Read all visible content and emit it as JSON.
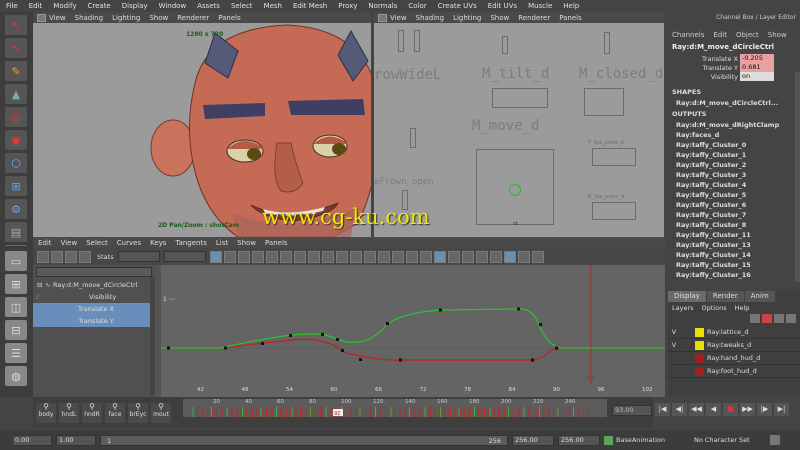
{
  "menubar": [
    "File",
    "Edit",
    "Modify",
    "Create",
    "Display",
    "Window",
    "Assets",
    "Select",
    "Mesh",
    "Edit Mesh",
    "Proxy",
    "Normals",
    "Color",
    "Create UVs",
    "Edit UVs",
    "Muscle",
    "Help"
  ],
  "viewport_left": {
    "menu": [
      "View",
      "Shading",
      "Lighting",
      "Show",
      "Renderer",
      "Panels"
    ],
    "resolution": "1280 x 720",
    "hud": "2D Pan/Zoom : shotCam"
  },
  "viewport_right": {
    "menu": [
      "View",
      "Shading",
      "Lighting",
      "Show",
      "Renderer",
      "Panels"
    ],
    "labels": {
      "frown": "rowWideL",
      "tilt": "M_tilt_d",
      "closed": "M_closed_d",
      "move": "M_move_d",
      "frown_open": "eFrown_open",
      "lips_press": "T_lips_press_d",
      "lips_press2": "B_lips_press_d",
      "shape_label": "ot"
    }
  },
  "watermark": "www.cg-ku.com",
  "channelbox": {
    "title": "Channel Box / Layer Editor",
    "menus": [
      "Channels",
      "Edit",
      "Object",
      "Show"
    ],
    "node": "Ray:d:M_move_dCircleCtrl",
    "attrs": [
      {
        "label": "Translate X",
        "value": "-0.205"
      },
      {
        "label": "Translate Y",
        "value": "0.681"
      },
      {
        "label": "Visibility",
        "value": "on"
      }
    ],
    "shapes_label": "SHAPES",
    "shape_item": "Ray:d:M_move_dCircleCtrl...",
    "outputs_label": "OUTPUTS",
    "outputs": [
      "Ray:d:M_move_dRightClamp",
      "Ray:faces_d",
      "Ray:taffy_Cluster_0",
      "Ray:taffy_Cluster_1",
      "Ray:taffy_Cluster_2",
      "Ray:taffy_Cluster_3",
      "Ray:taffy_Cluster_4",
      "Ray:taffy_Cluster_5",
      "Ray:taffy_Cluster_6",
      "Ray:taffy_Cluster_7",
      "Ray:taffy_Cluster_8",
      "Ray:taffy_Cluster_11",
      "Ray:taffy_Cluster_13",
      "Ray:taffy_Cluster_14",
      "Ray:taffy_Cluster_15",
      "Ray:taffy_Cluster_16"
    ]
  },
  "layer_editor": {
    "tabs": [
      "Display",
      "Render",
      "Anim"
    ],
    "menus": [
      "Layers",
      "Options",
      "Help"
    ],
    "layers": [
      {
        "v": "V",
        "name": "Ray:lattice_d",
        "color": "#e8e000"
      },
      {
        "v": "V",
        "name": "Ray:tweaks_d",
        "color": "#e8e000"
      },
      {
        "v": "",
        "name": "Ray:hand_hud_d",
        "color": "#a02020"
      },
      {
        "v": "",
        "name": "Ray:foot_hud_d",
        "color": "#a02020"
      }
    ]
  },
  "graph_editor": {
    "menu": [
      "Edit",
      "View",
      "Select",
      "Curves",
      "Keys",
      "Tangents",
      "List",
      "Show",
      "Panels"
    ],
    "stats_label": "Stats",
    "outliner_node": "Ray:d:M_move_dCircleCtrl",
    "outliner_attrs": [
      "Visibility",
      "Translate X",
      "Translate Y"
    ],
    "y_label": "1",
    "x_ticks": [
      "42",
      "48",
      "54",
      "60",
      "66",
      "72",
      "78",
      "84",
      "90",
      "96",
      "102"
    ],
    "current_frame_marker": "93"
  },
  "timeline": {
    "shelf_buttons": [
      "body",
      "hndL",
      "hndR",
      "face",
      "brEyc",
      "mout"
    ],
    "ticks": [
      "20",
      "40",
      "60",
      "80",
      "100",
      "120",
      "140",
      "160",
      "180",
      "200",
      "220",
      "240"
    ],
    "current_frame": "92",
    "current_frame_field": "93.00"
  },
  "range": {
    "start": "0.00",
    "field2": "1.00",
    "slider_start": "1",
    "slider_end": "256",
    "end1": "256.00",
    "end2": "256.00",
    "anim_layer": "BaseAnimation",
    "character_set": "No Character Set"
  },
  "colors": {
    "selection": "#6a8ebb",
    "highlight_attr": "#e8a0a0",
    "watermark": "#f3e800",
    "curve_red": "#c02020",
    "curve_green": "#30c030"
  }
}
